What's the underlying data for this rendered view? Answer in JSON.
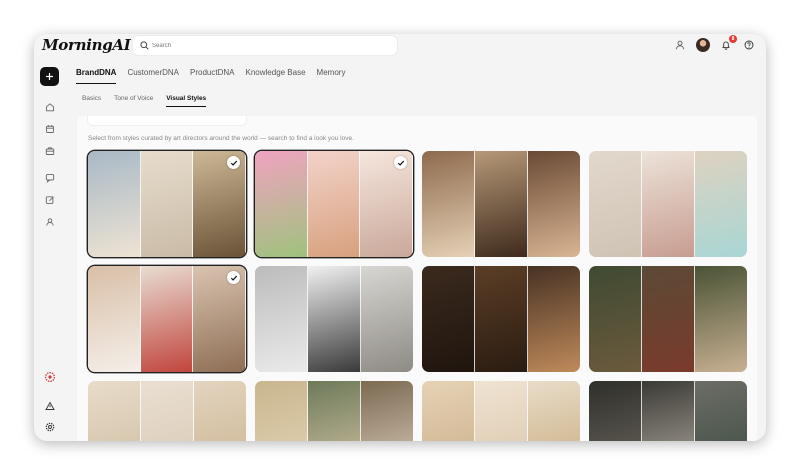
{
  "app": {
    "logo": "MorningAI"
  },
  "search": {
    "placeholder": "Search"
  },
  "notifications": {
    "count": "8"
  },
  "tabs": [
    {
      "label": "BrandDNA",
      "active": true
    },
    {
      "label": "CustomerDNA",
      "active": false
    },
    {
      "label": "ProductDNA",
      "active": false
    },
    {
      "label": "Knowledge Base",
      "active": false
    },
    {
      "label": "Memory",
      "active": false
    }
  ],
  "subtabs": [
    {
      "label": "Basics",
      "active": false
    },
    {
      "label": "Tone of Voice",
      "active": false
    },
    {
      "label": "Visual Styles",
      "active": true
    }
  ],
  "hint": "Select from styles curated by art directors around the world — search to find a look you love.",
  "icons": {
    "sidebar": [
      "plus-icon",
      "home-icon",
      "calendar-icon",
      "briefcase-icon",
      "chat-icon",
      "edit-icon",
      "user-icon",
      "brand-flower-icon",
      "alert-triangle-icon",
      "settings-icon"
    ],
    "top": [
      "user-icon",
      "avatar",
      "bell-icon",
      "help-icon"
    ]
  },
  "colors": {
    "accent": "#111111",
    "badge": "#e53935",
    "brand_flower": "#d23b3b"
  },
  "styles": [
    {
      "selected": true,
      "panels": [
        [
          "#a8b9c6",
          "#eee3d3"
        ],
        [
          "#e7dccd",
          "#c9bba6"
        ],
        [
          "#cdb897",
          "#6a5236"
        ]
      ]
    },
    {
      "selected": true,
      "panels": [
        [
          "#f0a3c0",
          "#9fc27d"
        ],
        [
          "#f2d3c9",
          "#d8a07e"
        ],
        [
          "#f6e6dd",
          "#c9a89a"
        ]
      ]
    },
    {
      "selected": false,
      "panels": [
        [
          "#8e6a4d",
          "#e5d1b6"
        ],
        [
          "#b59877",
          "#3e2a1c"
        ],
        [
          "#6a4a35",
          "#d9b593"
        ]
      ]
    },
    {
      "selected": false,
      "panels": [
        [
          "#e2d8cc",
          "#cfc3b4"
        ],
        [
          "#ece3d9",
          "#c89c90"
        ],
        [
          "#ded2c0",
          "#a8d6d4"
        ]
      ]
    },
    {
      "selected": true,
      "panels": [
        [
          "#d9bfa7",
          "#f4efe9"
        ],
        [
          "#e8ddd2",
          "#c1453d"
        ],
        [
          "#d9c4b0",
          "#8e6e55"
        ]
      ]
    },
    {
      "selected": false,
      "panels": [
        [
          "#bcbcbc",
          "#eaeaea"
        ],
        [
          "#f1f1f1",
          "#3a3a3a"
        ],
        [
          "#d8d6d2",
          "#8e8b85"
        ]
      ]
    },
    {
      "selected": false,
      "panels": [
        [
          "#3b2a1e",
          "#1f150e"
        ],
        [
          "#5b3e26",
          "#2a1c11"
        ],
        [
          "#473224",
          "#bf8a5a"
        ]
      ]
    },
    {
      "selected": false,
      "panels": [
        [
          "#3f4a32",
          "#6b5a3d"
        ],
        [
          "#5b4a36",
          "#7a3a2c"
        ],
        [
          "#4a5336",
          "#c8b092"
        ]
      ]
    },
    {
      "selected": false,
      "panels": [
        [
          "#e8dcc9",
          "#cdbba0"
        ],
        [
          "#eadfd1",
          "#d6c7b3"
        ],
        [
          "#e3d4bf",
          "#c9b28f"
        ]
      ]
    },
    {
      "selected": false,
      "panels": [
        [
          "#c9b68f",
          "#e6d6b8"
        ],
        [
          "#6d7a5a",
          "#d9c8a8"
        ],
        [
          "#7c6a52",
          "#e0d3c2"
        ]
      ]
    },
    {
      "selected": false,
      "panels": [
        [
          "#e6d2b6",
          "#c9ac86"
        ],
        [
          "#efe3d2",
          "#d9c4a7"
        ],
        [
          "#e8dcc9",
          "#c7a978"
        ]
      ]
    },
    {
      "selected": false,
      "panels": [
        [
          "#2f2f2b",
          "#6e6a60"
        ],
        [
          "#3b3a35",
          "#b8b2a6"
        ],
        [
          "#6c6d65",
          "#3a4b3f"
        ]
      ]
    }
  ]
}
